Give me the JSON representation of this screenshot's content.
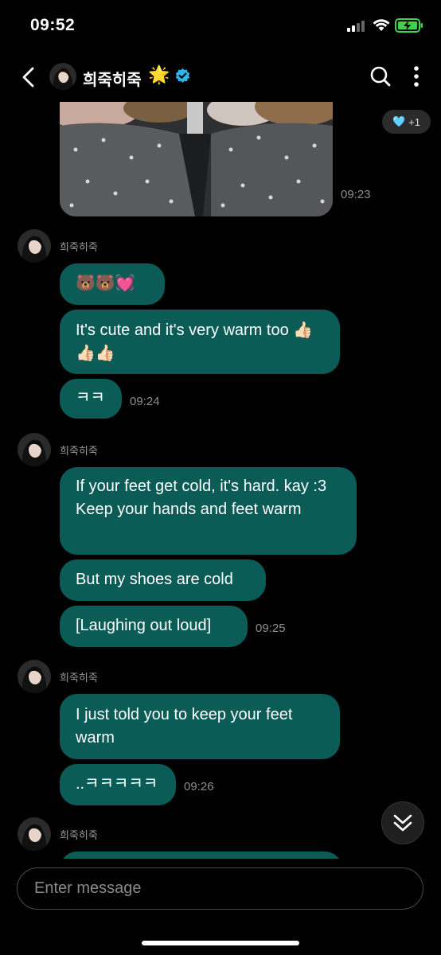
{
  "status_bar": {
    "time": "09:52"
  },
  "header": {
    "name": "희죽히죽",
    "badge_emoji": "🌟"
  },
  "photo_message": {
    "time": "09:23",
    "reaction": {
      "emoji": "🩵",
      "count": "+1"
    }
  },
  "groups": [
    {
      "sender": "희죽히죽",
      "messages": [
        {
          "text": "🐻🐻💓"
        },
        {
          "text": "It's cute and it's very warm too 👍🏻👍🏻👍🏻"
        },
        {
          "text": "ㅋㅋ",
          "time": "09:24"
        }
      ]
    },
    {
      "sender": "희죽히죽",
      "messages": [
        {
          "text": "If your feet get cold, it's hard. kay :3 Keep your hands and feet warm"
        },
        {
          "text": "But my shoes are cold"
        },
        {
          "text": "[Laughing out loud]",
          "time": "09:25"
        }
      ]
    },
    {
      "sender": "희죽히죽",
      "messages": [
        {
          "text": "I just told you to keep your feet warm"
        },
        {
          "text": "..ㅋㅋㅋㅋㅋ",
          "time": "09:26"
        }
      ]
    },
    {
      "sender": "희죽히죽"
    }
  ],
  "composer": {
    "placeholder": "Enter message"
  },
  "colors": {
    "bubble": "#0b5c57",
    "background": "#000000",
    "verified": "#2fb3e8"
  }
}
